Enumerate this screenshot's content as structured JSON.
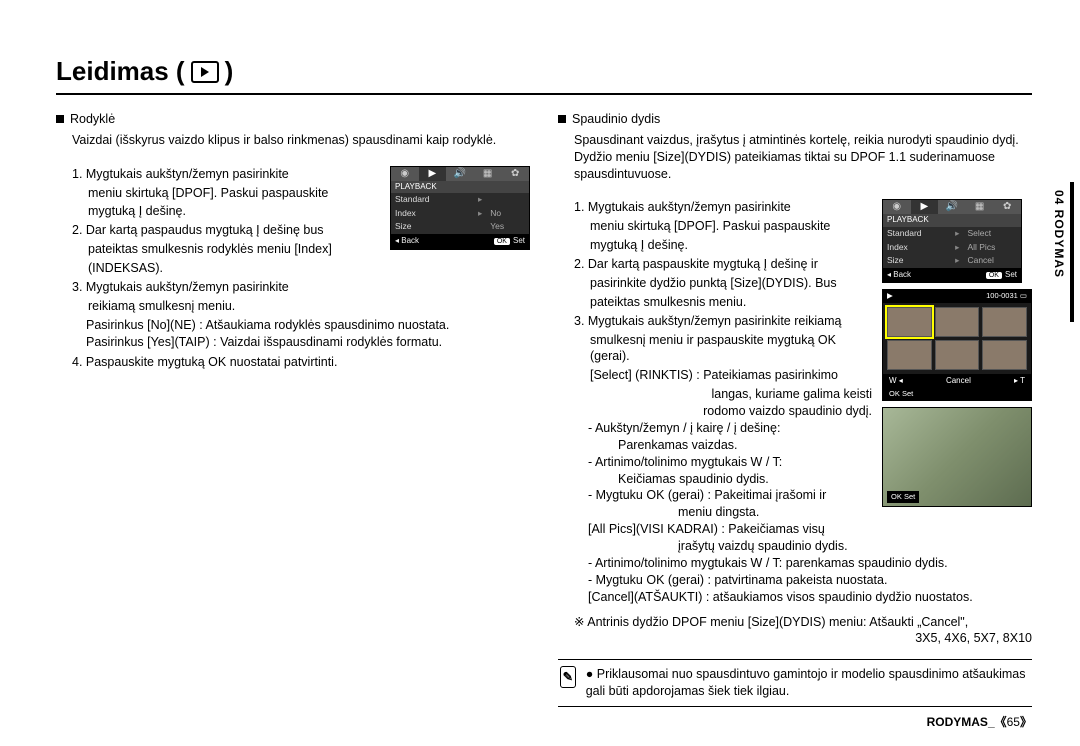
{
  "title": "Leidimas (",
  "title_suffix": ")",
  "left": {
    "heading": "Rodyklė",
    "intro": "Vaizdai (išskyrus vaizdo klipus ir balso rinkmenas) spausdinami kaip rodyklė.",
    "steps": {
      "s1a": "1. Mygtukais aukštyn/žemyn pasirinkite",
      "s1b": "meniu skirtuką [DPOF]. Paskui paspauskite",
      "s1c": "mygtuką Į dešinę.",
      "s2a": "2. Dar kartą paspaudus mygtuką Į dešinę bus",
      "s2b": "pateiktas smulkesnis rodyklės meniu [Index]",
      "s2c": "(INDEKSAS).",
      "s3a": "3. Mygtukais aukštyn/žemyn pasirinkite",
      "s3b": "reikiamą smulkesnį meniu.",
      "s3c": "Pasirinkus [No](NE)    : Atšaukiama rodyklės spausdinimo nuostata.",
      "s3d": "Pasirinkus [Yes](TAIP) : Vaizdai išspausdinami rodyklės formatu.",
      "s4": "4. Paspauskite mygtuką OK nuostatai patvirtinti."
    },
    "screen": {
      "label": "PLAYBACK",
      "rows": [
        {
          "k": "Standard",
          "v": ""
        },
        {
          "k": "Index",
          "v": "No"
        },
        {
          "k": "Size",
          "v": "Yes"
        }
      ],
      "back": "Back",
      "set": "Set",
      "ok": "OK"
    }
  },
  "right": {
    "heading": "Spaudinio dydis",
    "intro1": "Spausdinant vaizdus, įrašytus į atmintinės kortelę, reikia nurodyti spaudinio dydį. Dydžio meniu [Size](DYDIS) pateikiamas tiktai su DPOF 1.1 suderinamuose spausdintuvuose.",
    "steps": {
      "s1a": "1. Mygtukais aukštyn/žemyn pasirinkite",
      "s1b": "meniu skirtuką [DPOF]. Paskui paspauskite",
      "s1c": "mygtuką Į dešinę.",
      "s2a": "2. Dar kartą paspauskite mygtuką Į dešinę ir",
      "s2b": "pasirinkite dydžio punktą [Size](DYDIS). Bus",
      "s2c": "pateiktas smulkesnis meniu.",
      "s3a": "3. Mygtukais aukštyn/žemyn pasirinkite reikiamą",
      "s3b": "smulkesnį meniu ir paspauskite mygtuką OK (gerai).",
      "sel1": "[Select] (RINKTIS) : Pateikiamas pasirinkimo",
      "sel2": "langas, kuriame galima keisti",
      "sel3": "rodomo vaizdo spaudinio dydį.",
      "b1": "- Aukštyn/žemyn / į kairę / į dešinę:",
      "b1b": "Parenkamas vaizdas.",
      "b2": "- Artinimo/tolinimo mygtukais W / T:",
      "b2b": "Keičiamas spaudinio dydis.",
      "b3": "- Mygtuku OK (gerai) : Pakeitimai įrašomi ir",
      "b3b": "meniu dingsta.",
      "all": "[All Pics](VISI KADRAI) : Pakeičiamas visų",
      "allb": "įrašytų vaizdų spaudinio dydis.",
      "b4": "- Artinimo/tolinimo mygtukais W / T: parenkamas spaudinio dydis.",
      "b5": "- Mygtuku OK (gerai) :  patvirtinama pakeista nuostata.",
      "cancel": "[Cancel](ATŠAUKTI) : atšaukiamos visos spaudinio dydžio nuostatos.",
      "note": "※ Antrinis dydžio DPOF meniu [Size](DYDIS) meniu: Atšaukti „Cancel\",",
      "note2": "3X5, 4X6, 5X7, 8X10"
    },
    "screen": {
      "label": "PLAYBACK",
      "rows": [
        {
          "k": "Standard",
          "v": "Select"
        },
        {
          "k": "Index",
          "v": "All Pics"
        },
        {
          "k": "Size",
          "v": "Cancel"
        }
      ],
      "back": "Back",
      "set": "Set",
      "ok": "OK"
    },
    "photo": {
      "counter": "100-0031",
      "w": "W",
      "t": "T",
      "cancel": "Cancel",
      "okset": "Set",
      "ok": "OK"
    },
    "footnote": "Priklausomai nuo spausdintuvo gamintojo ir modelio spausdinimo atšaukimas gali būti apdorojamas šiek tiek ilgiau."
  },
  "sidetab": "04 RODYMAS",
  "footer_label": "RODYMAS",
  "footer_page": "65"
}
